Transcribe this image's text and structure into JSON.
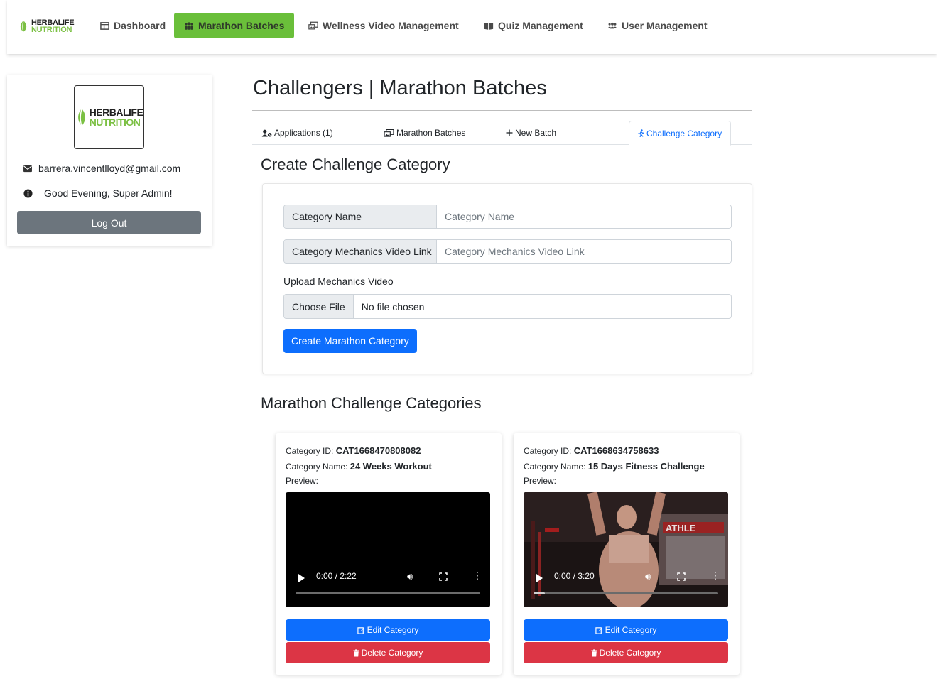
{
  "brand": {
    "line1": "HERBALIFE",
    "line2": "NUTRITION"
  },
  "nav": {
    "dashboard": "Dashboard",
    "marathon_batches": "Marathon Batches",
    "wellness_video": "Wellness Video Management",
    "quiz": "Quiz Management",
    "user": "User Management"
  },
  "profile": {
    "email": "barrera.vincentlloyd@gmail.com",
    "greeting": "Good Evening, Super Admin!",
    "logout": "Log Out"
  },
  "page": {
    "title": "Challengers | Marathon Batches"
  },
  "tabs": {
    "applications": "Applications (1)",
    "marathon_batches": "Marathon Batches",
    "new_batch": "New Batch",
    "challenge_category": "Challenge Category"
  },
  "form": {
    "heading": "Create Challenge Category",
    "category_name_label": "Category Name",
    "category_name_placeholder": "Category Name",
    "video_link_label": "Category Mechanics Video Link",
    "video_link_placeholder": "Category Mechanics Video Link",
    "upload_label": "Upload Mechanics Video",
    "choose_file": "Choose File",
    "file_status": "No file chosen",
    "submit": "Create Marathon Category"
  },
  "categories_heading": "Marathon Challenge Categories",
  "categories": [
    {
      "id_label": "Category ID:",
      "id": "CAT1668470808082",
      "name_label": "Category Name:",
      "name": "24 Weeks Workout",
      "preview_label": "Preview:",
      "time": "0:00 / 2:22",
      "progress": 0,
      "edit": "Edit Category",
      "delete": "Delete Category"
    },
    {
      "id_label": "Category ID:",
      "id": "CAT1668634758633",
      "name_label": "Category Name:",
      "name": "15 Days Fitness Challenge",
      "preview_label": "Preview:",
      "time": "0:00 / 3:20",
      "progress": 0.06,
      "edit": "Edit Category",
      "delete": "Delete Category"
    }
  ],
  "colors": {
    "accent_green": "#6abf3a",
    "primary": "#0d6efd",
    "danger": "#dc3545",
    "secondary": "#6c757d"
  }
}
